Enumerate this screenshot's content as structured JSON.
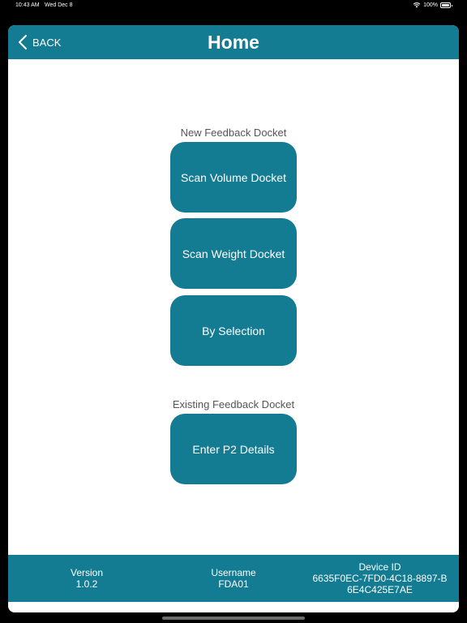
{
  "status_bar": {
    "time": "10:43 AM",
    "date": "Wed Dec 8",
    "battery": "100%"
  },
  "nav": {
    "back_label": "BACK",
    "title": "Home"
  },
  "new_section": {
    "label": "New Feedback Docket",
    "buttons": [
      "Scan Volume Docket",
      "Scan Weight Docket",
      "By Selection"
    ]
  },
  "existing_section": {
    "label": "Existing Feedback Docket",
    "buttons": [
      "Enter P2 Details"
    ]
  },
  "footer": {
    "version_label": "Version",
    "version_value": "1.0.2",
    "username_label": "Username",
    "username_value": "FDA01",
    "device_label": "Device ID",
    "device_value": "6635F0EC-7FD0-4C18-8897-B6E4C425E7AE"
  },
  "colors": {
    "primary": "#137b92",
    "background": "#ffffff",
    "section_text": "#555555"
  },
  "icons": [
    "wifi-icon",
    "battery-icon",
    "back-chevron-icon"
  ]
}
